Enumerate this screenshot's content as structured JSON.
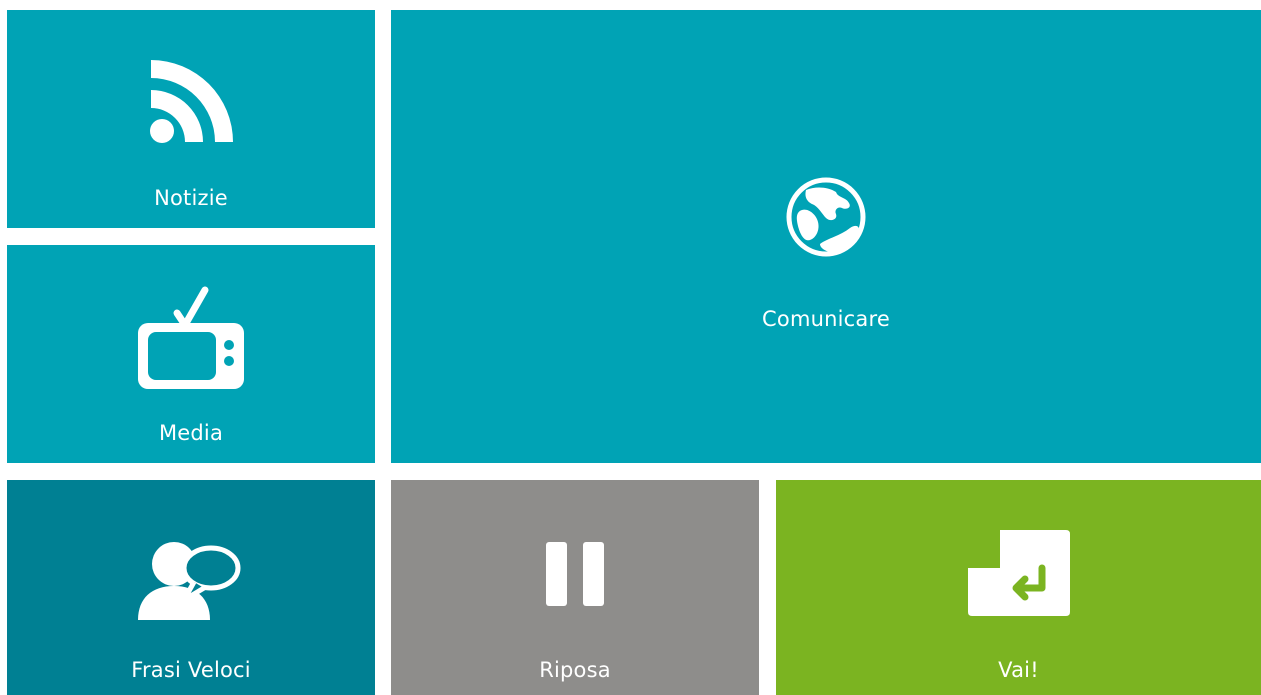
{
  "colors": {
    "teal": "#00a3b5",
    "dark_teal": "#008093",
    "gray": "#8e8d8b",
    "green": "#7bb421",
    "icon": "#ffffff"
  },
  "tiles": {
    "news": {
      "label": "Notizie",
      "icon": "rss-icon"
    },
    "media": {
      "label": "Media",
      "icon": "tv-icon"
    },
    "comm": {
      "label": "Comunicare",
      "icon": "globe-icon"
    },
    "quick": {
      "label": "Frasi Veloci",
      "icon": "speech-person-icon"
    },
    "rest": {
      "label": "Riposa",
      "icon": "pause-icon"
    },
    "go": {
      "label": "Vai!",
      "icon": "enter-key-icon"
    }
  }
}
